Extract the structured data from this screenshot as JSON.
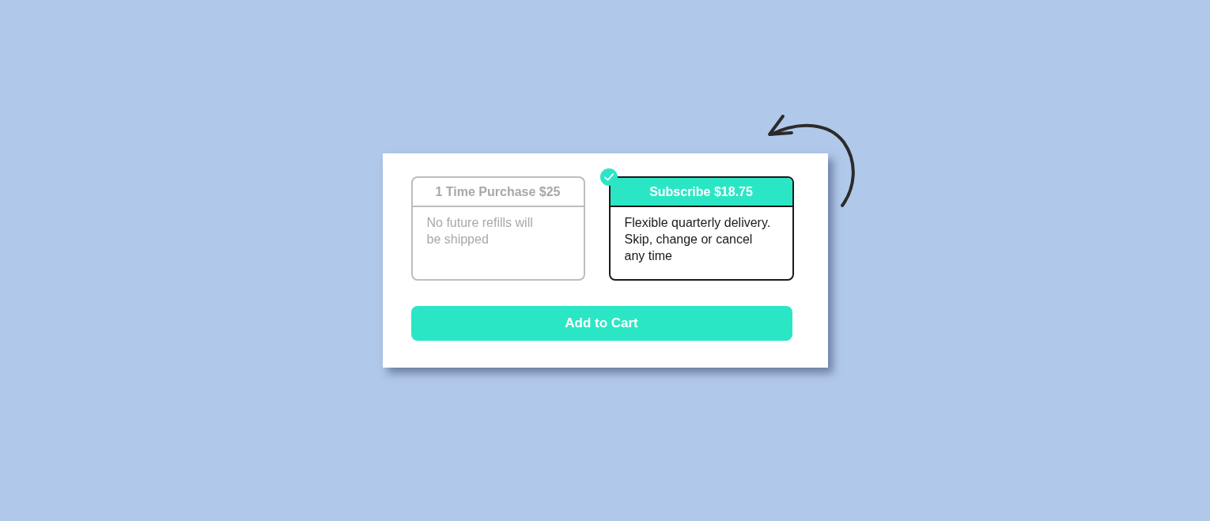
{
  "options": [
    {
      "title": "1 Time Purchase $25",
      "description": "No future refills will be shipped",
      "selected": false
    },
    {
      "title": "Subscribe $18.75",
      "description": "Flexible quarterly delivery. Skip, change or cancel any time",
      "selected": true
    }
  ],
  "button": {
    "label": "Add to Cart"
  }
}
